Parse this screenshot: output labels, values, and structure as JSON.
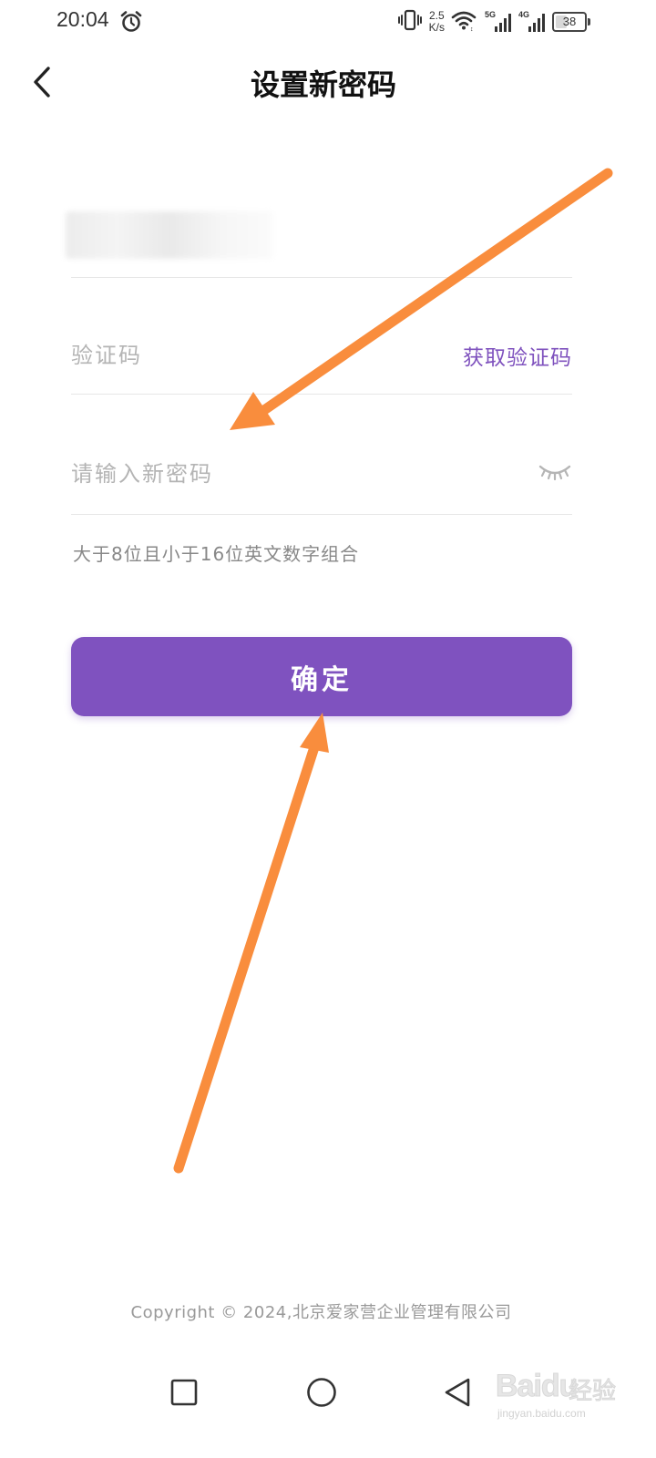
{
  "status_bar": {
    "time": "20:04",
    "net_speed_value": "2.5",
    "net_speed_unit": "K/s",
    "signal_1_label": "5G",
    "signal_2_label": "4G",
    "battery": "38",
    "icons": [
      "alarm-icon",
      "vibrate-icon",
      "wifi-icon",
      "signal-icon",
      "battery-icon"
    ]
  },
  "header": {
    "title": "设置新密码",
    "back_icon": "chevron-left-icon"
  },
  "form": {
    "code_placeholder": "验证码",
    "get_code_label": "获取验证码",
    "password_placeholder": "请输入新密码",
    "eye_icon": "eye-closed-icon",
    "hint": "大于8位且小于16位英文数字组合",
    "confirm_label": "确定"
  },
  "footer": {
    "copyright": "Copyright © 2024,北京爱家营企业管理有限公司"
  },
  "nav_bar": {
    "icons": [
      "square-recent-icon",
      "circle-home-icon",
      "triangle-back-icon"
    ]
  },
  "watermark": {
    "brand": "Baidu",
    "jingyan": "经验",
    "domain": "jingyan.baidu.com"
  },
  "colors": {
    "accent": "#7f52bf",
    "annotation_arrow": "#f98d3d"
  }
}
